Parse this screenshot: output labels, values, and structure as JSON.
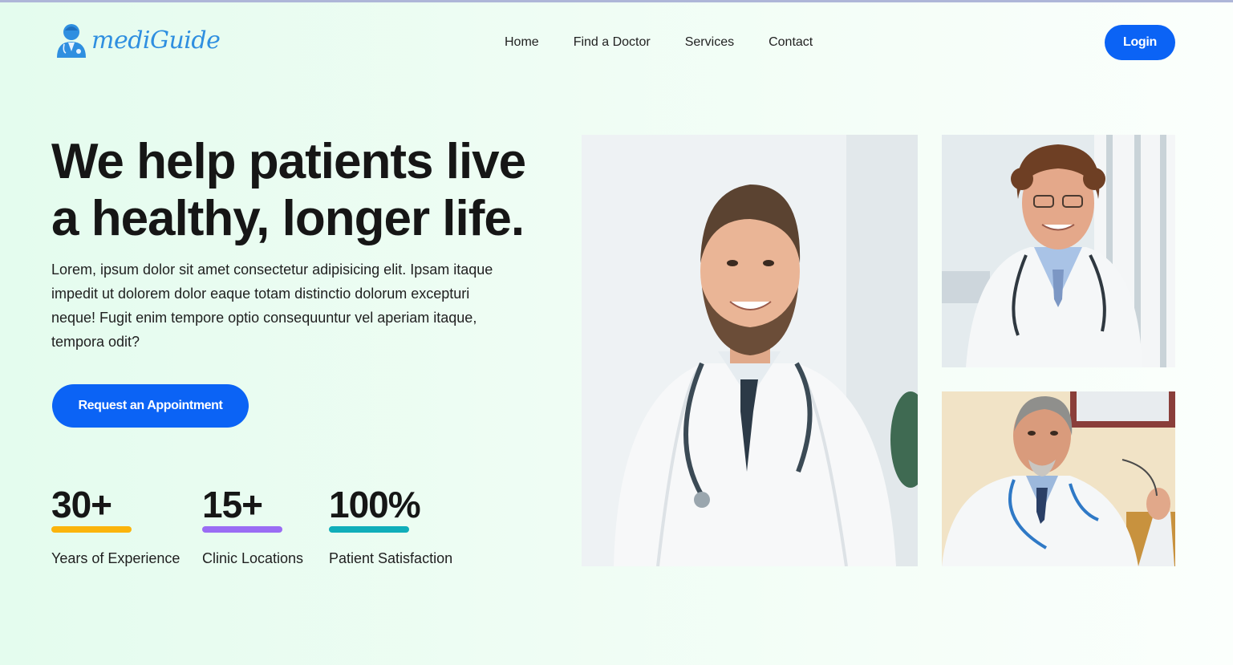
{
  "brand": {
    "name": "mediGuide",
    "icon": "doctor-icon",
    "color": "#2f8fe0"
  },
  "nav": {
    "items": [
      {
        "label": "Home"
      },
      {
        "label": "Find a Doctor"
      },
      {
        "label": "Services"
      },
      {
        "label": "Contact"
      }
    ]
  },
  "header": {
    "login_label": "Login"
  },
  "hero": {
    "title_line1": "We help patients live",
    "title_line2": "a healthy, longer life.",
    "subtitle": "Lorem, ipsum dolor sit amet consectetur adipisicing elit. Ipsam itaque impedit ut dolorem dolor eaque totam distinctio dolorum excepturi neque! Fugit enim tempore optio consequuntur vel aperiam itaque, tempora odit?",
    "cta_label": "Request an Appointment"
  },
  "stats": [
    {
      "value": "30+",
      "label": "Years of Experience",
      "color": "#fbb40c"
    },
    {
      "value": "15+",
      "label": "Clinic Locations",
      "color": "#9a6cf4"
    },
    {
      "value": "100%",
      "label": "Patient Satisfaction",
      "color": "#10aeba"
    }
  ],
  "images": [
    {
      "name": "doctor-photo-main"
    },
    {
      "name": "doctor-photo-curly-hair"
    },
    {
      "name": "doctor-photo-senior"
    }
  ],
  "colors": {
    "accent": "#0b63f5",
    "text": "#161616"
  }
}
